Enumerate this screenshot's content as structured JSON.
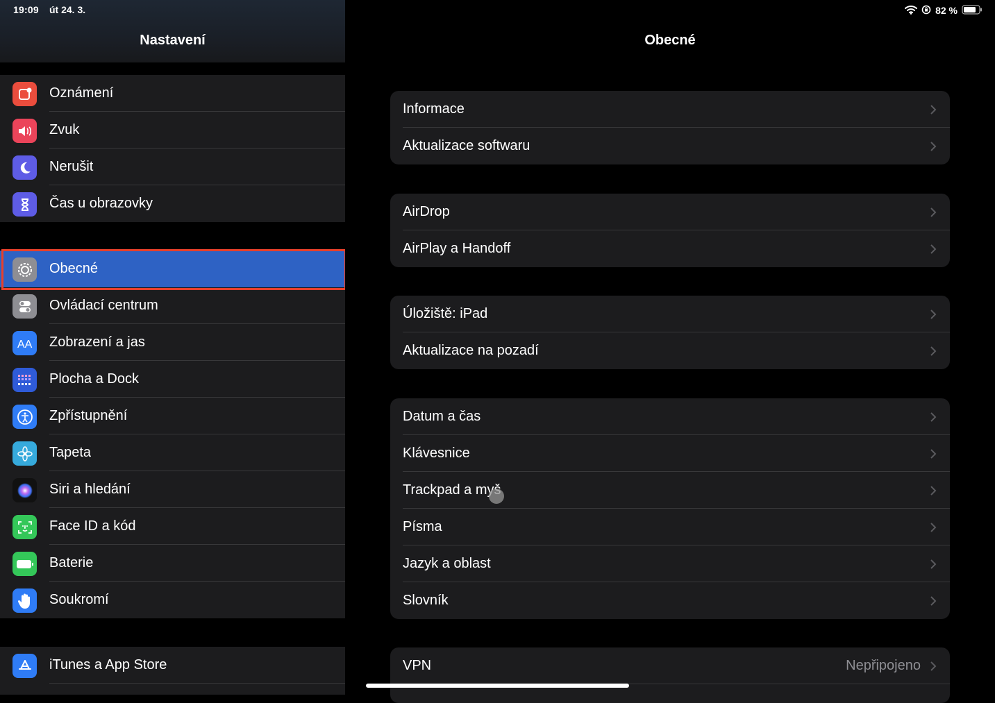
{
  "status_bar": {
    "time": "19:09",
    "date": "út 24. 3.",
    "battery_percent": "82 %",
    "icons": [
      "wifi-icon",
      "orientation-lock-icon",
      "battery-icon"
    ]
  },
  "sidebar": {
    "title": "Nastavení",
    "selected": "Obecné",
    "groups": [
      [
        {
          "label": "Oznámení",
          "icon": "notifications-icon",
          "color": "#eb4d3d"
        },
        {
          "label": "Zvuk",
          "icon": "speaker-icon",
          "color": "#eb445a"
        },
        {
          "label": "Nerušit",
          "icon": "moon-icon",
          "color": "#5e5ce6"
        },
        {
          "label": "Čas u obrazovky",
          "icon": "hourglass-icon",
          "color": "#5e5ce6"
        }
      ],
      [
        {
          "label": "Obecné",
          "icon": "gear-icon",
          "color": "#8e8e93"
        },
        {
          "label": "Ovládací centrum",
          "icon": "toggles-icon",
          "color": "#8e8e93"
        },
        {
          "label": "Zobrazení a jas",
          "icon": "text-size-icon",
          "color": "#2f7cf6"
        },
        {
          "label": "Plocha a Dock",
          "icon": "home-grid-icon",
          "color": "#2f5bd8"
        },
        {
          "label": "Zpřístupnění",
          "icon": "accessibility-icon",
          "color": "#2f7cf6"
        },
        {
          "label": "Tapeta",
          "icon": "flower-icon",
          "color": "#36aadc"
        },
        {
          "label": "Siri a hledání",
          "icon": "siri-icon",
          "color": "#222"
        },
        {
          "label": "Face ID a kód",
          "icon": "face-id-icon",
          "color": "#34c759"
        },
        {
          "label": "Baterie",
          "icon": "battery-icon",
          "color": "#34c759"
        },
        {
          "label": "Soukromí",
          "icon": "hand-icon",
          "color": "#2f7cf6"
        }
      ],
      [
        {
          "label": "iTunes a App Store",
          "icon": "app-store-icon",
          "color": "#2f7cf6"
        }
      ]
    ]
  },
  "detail": {
    "title": "Obecné",
    "groups": [
      [
        {
          "label": "Informace"
        },
        {
          "label": "Aktualizace softwaru"
        }
      ],
      [
        {
          "label": "AirDrop"
        },
        {
          "label": "AirPlay a Handoff"
        }
      ],
      [
        {
          "label": "Úložiště: iPad"
        },
        {
          "label": "Aktualizace na pozadí"
        }
      ],
      [
        {
          "label": "Datum a čas"
        },
        {
          "label": "Klávesnice"
        },
        {
          "label": "Trackpad a myš"
        },
        {
          "label": "Písma"
        },
        {
          "label": "Jazyk a oblast"
        },
        {
          "label": "Slovník"
        }
      ],
      [
        {
          "label": "VPN",
          "value": "Nepřipojeno"
        }
      ]
    ]
  }
}
